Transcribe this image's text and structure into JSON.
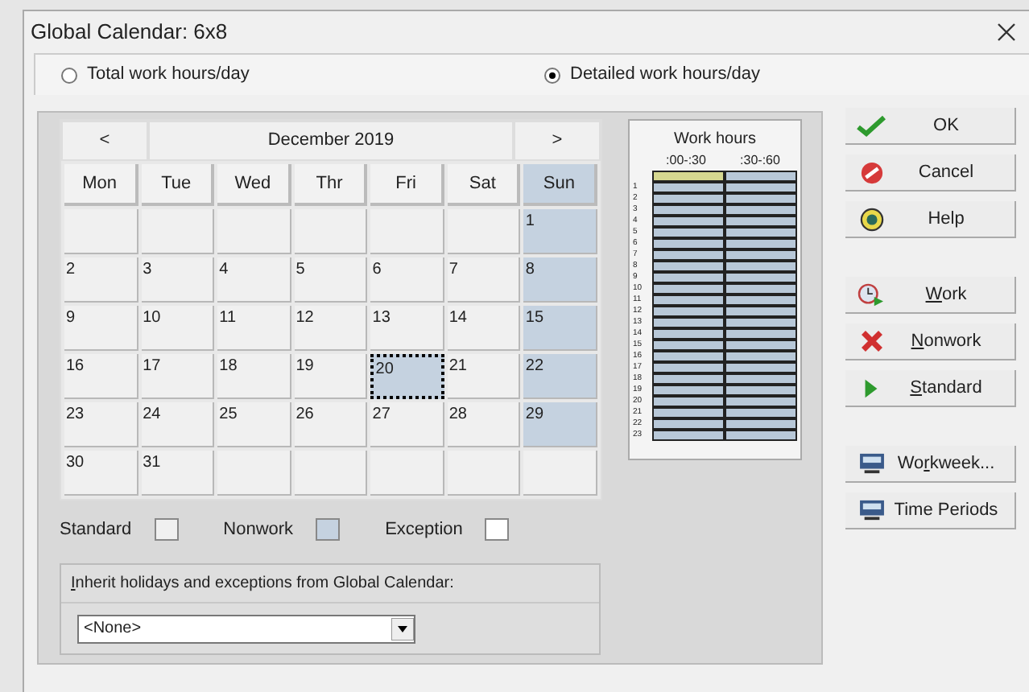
{
  "window": {
    "title": "Global Calendar: 6x8"
  },
  "mode_options": [
    {
      "label": "Total work hours/day",
      "selected": false
    },
    {
      "label": "Detailed work hours/day",
      "selected": true
    }
  ],
  "calendar": {
    "prev": "<",
    "month": "December 2019",
    "next": ">",
    "weekdays": [
      {
        "label": "Mon",
        "kind": "standard"
      },
      {
        "label": "Tue",
        "kind": "standard"
      },
      {
        "label": "Wed",
        "kind": "standard"
      },
      {
        "label": "Thr",
        "kind": "standard"
      },
      {
        "label": "Fri",
        "kind": "standard"
      },
      {
        "label": "Sat",
        "kind": "standard"
      },
      {
        "label": "Sun",
        "kind": "nonwork"
      }
    ],
    "weeks": [
      [
        {
          "kind": "empty",
          "selected": false
        },
        {
          "kind": "empty",
          "selected": false
        },
        {
          "kind": "empty",
          "selected": false
        },
        {
          "kind": "empty",
          "selected": false
        },
        {
          "kind": "empty",
          "selected": false
        },
        {
          "kind": "empty",
          "selected": false
        },
        {
          "day": "1",
          "kind": "nonwork",
          "selected": false
        }
      ],
      [
        {
          "day": "2",
          "kind": "standard",
          "selected": false
        },
        {
          "day": "3",
          "kind": "standard",
          "selected": false
        },
        {
          "day": "4",
          "kind": "standard",
          "selected": false
        },
        {
          "day": "5",
          "kind": "standard",
          "selected": false
        },
        {
          "day": "6",
          "kind": "standard",
          "selected": false
        },
        {
          "day": "7",
          "kind": "standard",
          "selected": false
        },
        {
          "day": "8",
          "kind": "nonwork",
          "selected": false
        }
      ],
      [
        {
          "day": "9",
          "kind": "standard",
          "selected": false
        },
        {
          "day": "10",
          "kind": "standard",
          "selected": false
        },
        {
          "day": "11",
          "kind": "standard",
          "selected": false
        },
        {
          "day": "12",
          "kind": "standard",
          "selected": false
        },
        {
          "day": "13",
          "kind": "standard",
          "selected": false
        },
        {
          "day": "14",
          "kind": "standard",
          "selected": false
        },
        {
          "day": "15",
          "kind": "nonwork",
          "selected": false
        }
      ],
      [
        {
          "day": "16",
          "kind": "standard",
          "selected": false
        },
        {
          "day": "17",
          "kind": "standard",
          "selected": false
        },
        {
          "day": "18",
          "kind": "standard",
          "selected": false
        },
        {
          "day": "19",
          "kind": "standard",
          "selected": false
        },
        {
          "day": "20",
          "kind": "nonwork",
          "selected": true
        },
        {
          "day": "21",
          "kind": "standard",
          "selected": false
        },
        {
          "day": "22",
          "kind": "nonwork",
          "selected": false
        }
      ],
      [
        {
          "day": "23",
          "kind": "standard",
          "selected": false
        },
        {
          "day": "24",
          "kind": "standard",
          "selected": false
        },
        {
          "day": "25",
          "kind": "standard",
          "selected": false
        },
        {
          "day": "26",
          "kind": "standard",
          "selected": false
        },
        {
          "day": "27",
          "kind": "standard",
          "selected": false
        },
        {
          "day": "28",
          "kind": "standard",
          "selected": false
        },
        {
          "day": "29",
          "kind": "nonwork",
          "selected": false
        }
      ],
      [
        {
          "day": "30",
          "kind": "standard",
          "selected": false
        },
        {
          "day": "31",
          "kind": "standard",
          "selected": false
        },
        {
          "kind": "empty",
          "selected": false
        },
        {
          "kind": "empty",
          "selected": false
        },
        {
          "kind": "empty",
          "selected": false
        },
        {
          "kind": "empty",
          "selected": false
        },
        {
          "kind": "empty",
          "selected": false
        }
      ]
    ]
  },
  "work_hours": {
    "title": "Work hours",
    "columns": [
      ":00-:30",
      ":30-:60"
    ],
    "rows": [
      {
        "cells": [
          {
            "selected": true
          },
          {
            "selected": false
          }
        ]
      },
      {
        "label": "1",
        "cells": [
          {
            "selected": false
          },
          {
            "selected": false
          }
        ]
      },
      {
        "label": "2",
        "cells": [
          {
            "selected": false
          },
          {
            "selected": false
          }
        ]
      },
      {
        "label": "3",
        "cells": [
          {
            "selected": false
          },
          {
            "selected": false
          }
        ]
      },
      {
        "label": "4",
        "cells": [
          {
            "selected": false
          },
          {
            "selected": false
          }
        ]
      },
      {
        "label": "5",
        "cells": [
          {
            "selected": false
          },
          {
            "selected": false
          }
        ]
      },
      {
        "label": "6",
        "cells": [
          {
            "selected": false
          },
          {
            "selected": false
          }
        ]
      },
      {
        "label": "7",
        "cells": [
          {
            "selected": false
          },
          {
            "selected": false
          }
        ]
      },
      {
        "label": "8",
        "cells": [
          {
            "selected": false
          },
          {
            "selected": false
          }
        ]
      },
      {
        "label": "9",
        "cells": [
          {
            "selected": false
          },
          {
            "selected": false
          }
        ]
      },
      {
        "label": "10",
        "cells": [
          {
            "selected": false
          },
          {
            "selected": false
          }
        ]
      },
      {
        "label": "11",
        "cells": [
          {
            "selected": false
          },
          {
            "selected": false
          }
        ]
      },
      {
        "label": "12",
        "cells": [
          {
            "selected": false
          },
          {
            "selected": false
          }
        ]
      },
      {
        "label": "13",
        "cells": [
          {
            "selected": false
          },
          {
            "selected": false
          }
        ]
      },
      {
        "label": "14",
        "cells": [
          {
            "selected": false
          },
          {
            "selected": false
          }
        ]
      },
      {
        "label": "15",
        "cells": [
          {
            "selected": false
          },
          {
            "selected": false
          }
        ]
      },
      {
        "label": "16",
        "cells": [
          {
            "selected": false
          },
          {
            "selected": false
          }
        ]
      },
      {
        "label": "17",
        "cells": [
          {
            "selected": false
          },
          {
            "selected": false
          }
        ]
      },
      {
        "label": "18",
        "cells": [
          {
            "selected": false
          },
          {
            "selected": false
          }
        ]
      },
      {
        "label": "19",
        "cells": [
          {
            "selected": false
          },
          {
            "selected": false
          }
        ]
      },
      {
        "label": "20",
        "cells": [
          {
            "selected": false
          },
          {
            "selected": false
          }
        ]
      },
      {
        "label": "21",
        "cells": [
          {
            "selected": false
          },
          {
            "selected": false
          }
        ]
      },
      {
        "label": "22",
        "cells": [
          {
            "selected": false
          },
          {
            "selected": false
          }
        ]
      },
      {
        "label": "23",
        "cells": [
          {
            "selected": false
          },
          {
            "selected": false
          }
        ]
      }
    ]
  },
  "legend": [
    {
      "label": "Standard",
      "kind": "standard"
    },
    {
      "label": "Nonwork",
      "kind": "nonwork"
    },
    {
      "label": "Exception",
      "kind": "exception"
    }
  ],
  "inherit": {
    "label": {
      "key": "I",
      "rest": "nherit holidays and exceptions from Global Calendar:"
    },
    "value": "<None>"
  },
  "buttons": [
    [
      {
        "label": "OK",
        "kind": "ok"
      },
      {
        "label": "Cancel",
        "kind": "cancel"
      },
      {
        "label": "Help",
        "kind": "help"
      }
    ],
    [
      {
        "label": {
          "key": "W",
          "rest": "ork"
        },
        "kind": "work"
      },
      {
        "label": {
          "key": "N",
          "rest": "onwork"
        },
        "kind": "nonwork"
      },
      {
        "label": {
          "key": "S",
          "rest": "tandard"
        },
        "kind": "standard"
      }
    ],
    [
      {
        "label": {
          "before": "Wo",
          "key": "r",
          "rest": "kweek..."
        },
        "kind": "workweek"
      },
      {
        "label": "Time Periods",
        "kind": "periods"
      }
    ]
  ]
}
